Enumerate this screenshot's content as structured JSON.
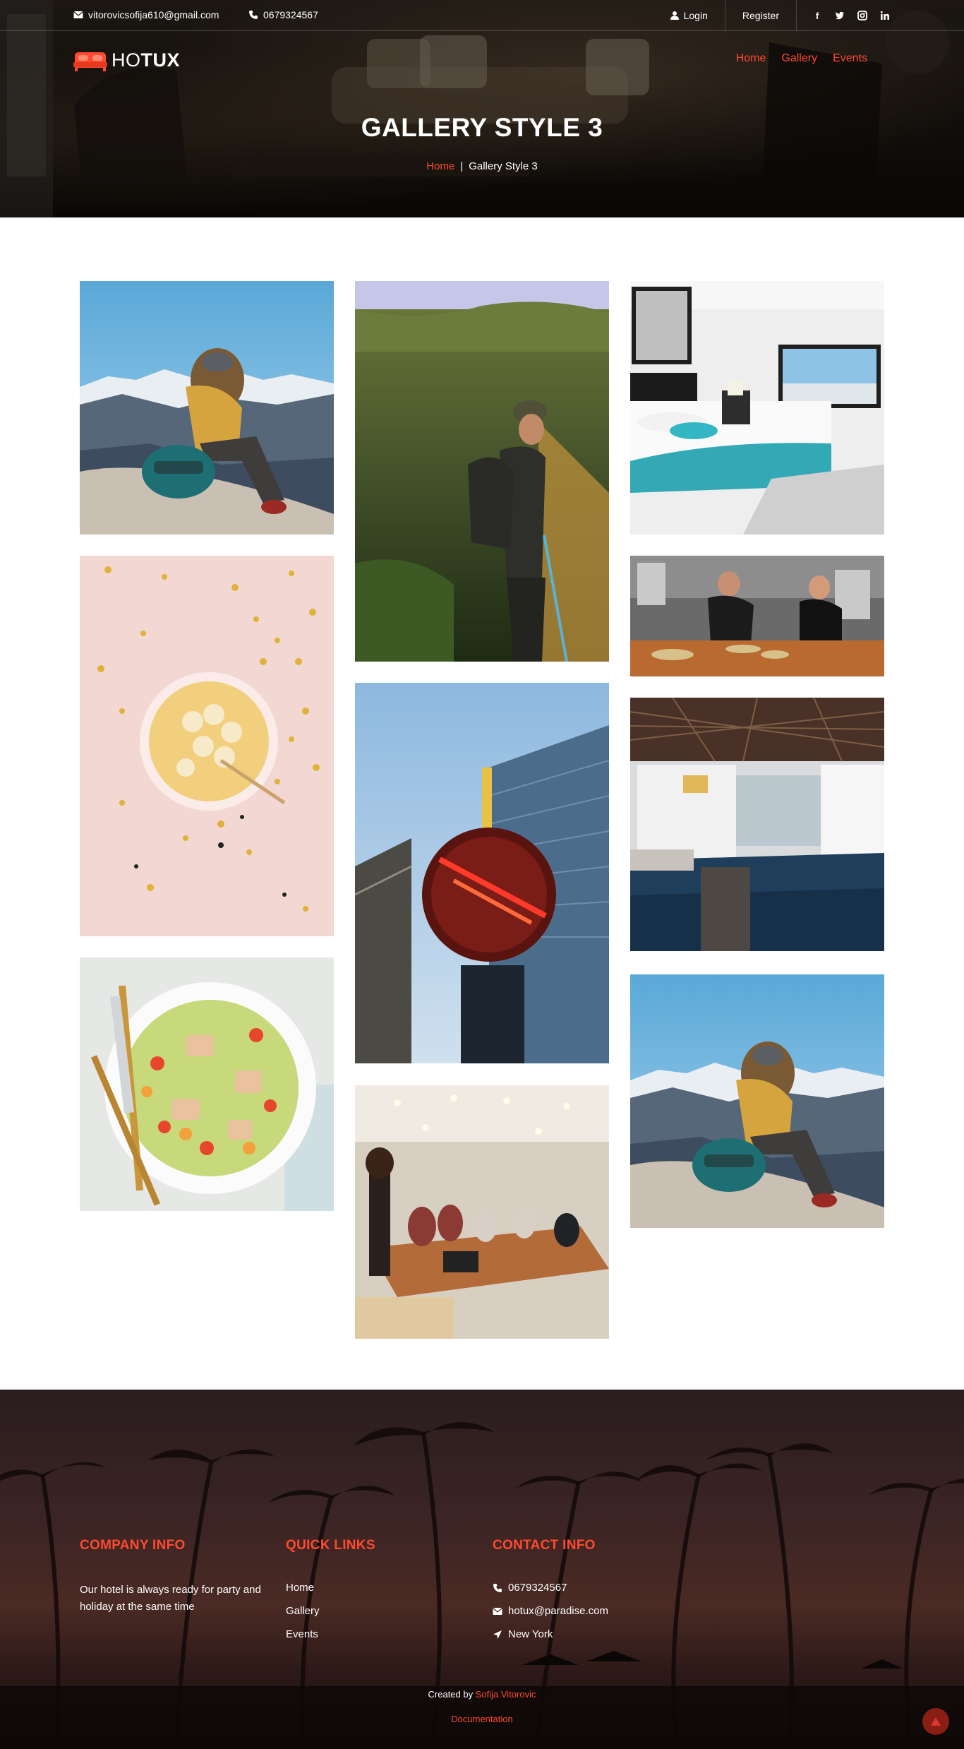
{
  "topbar": {
    "email": "vitorovicsofija610@gmail.com",
    "phone": "0679324567",
    "login_label": "Login",
    "register_label": "Register",
    "social": [
      {
        "icon": "facebook-icon",
        "glyph": "f"
      },
      {
        "icon": "twitter-icon",
        "glyph": "t"
      },
      {
        "icon": "instagram-icon",
        "glyph": "ig"
      },
      {
        "icon": "linkedin-icon",
        "glyph": "in"
      }
    ]
  },
  "brand": {
    "logo_light": "HO",
    "logo_bold": "TUX",
    "accent": "#ff4a2e"
  },
  "nav": {
    "items": [
      "Home",
      "Gallery",
      "Events"
    ]
  },
  "hero": {
    "title": "GALLERY STYLE 3",
    "breadcrumb_home": "Home",
    "breadcrumb_sep": "|",
    "breadcrumb_current": "Gallery Style 3"
  },
  "gallery": {
    "images": [
      {
        "name": "gallery-image-hiker-mountains"
      },
      {
        "name": "gallery-image-smoothie-bowl"
      },
      {
        "name": "gallery-image-salad"
      },
      {
        "name": "gallery-image-hiker-forest"
      },
      {
        "name": "gallery-image-hard-rock-cafe"
      },
      {
        "name": "gallery-image-meeting-room"
      },
      {
        "name": "gallery-image-hotel-bedroom"
      },
      {
        "name": "gallery-image-chefs-kitchen"
      },
      {
        "name": "gallery-image-architecture-pool"
      },
      {
        "name": "gallery-image-hiker-mountains-2"
      }
    ]
  },
  "footer": {
    "company_title": "COMPANY INFO",
    "company_text": "Our hotel is always ready for party and holiday at the same time",
    "links_title": "QUICK LINKS",
    "links": [
      "Home",
      "Gallery",
      "Events"
    ],
    "contact_title": "CONTACT INFO",
    "contact_phone": "0679324567",
    "contact_email": "hotux@paradise.com",
    "contact_location": "New York",
    "credit_prefix": "Created by",
    "credit_author": "Sofija Vitorovic",
    "documentation": "Documentation"
  }
}
